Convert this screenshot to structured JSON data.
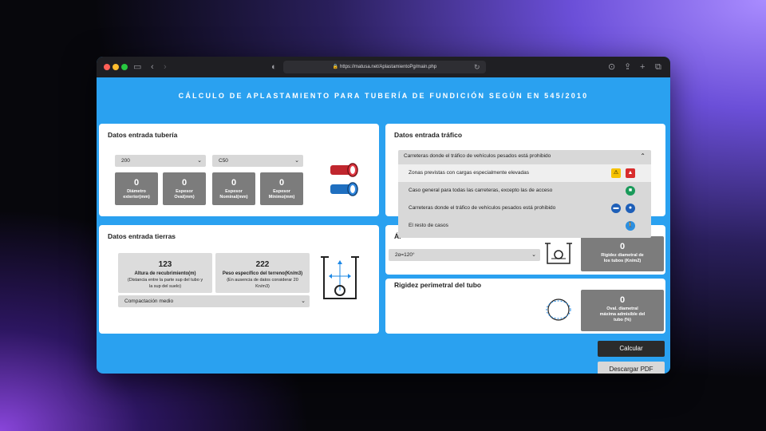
{
  "browser": {
    "url": "https://matusa.net/AplastamientoPg/main.php"
  },
  "app": {
    "title": "CÁLCULO DE APLASTAMIENTO PARA TUBERÍA DE FUNDICIÓN SEGÚN EN 545/2010"
  },
  "tuberia": {
    "title": "Datos entrada tubería",
    "diameter_select": "200",
    "class_select": "C50",
    "boxes": [
      {
        "value": "0",
        "label1": "Diámetro",
        "label2": "exterior(mm)"
      },
      {
        "value": "0",
        "label1": "Espesor",
        "label2": "Oval(mm)"
      },
      {
        "value": "0",
        "label1": "Espesor",
        "label2": "Nominal(mm)"
      },
      {
        "value": "0",
        "label1": "Espesor",
        "label2": "Mínimo(mm)"
      }
    ]
  },
  "tierras": {
    "title": "Datos entrada tierras",
    "altura": {
      "value": "123",
      "label": "Altura de recubrimiento(m)",
      "sub1": "(Distancia entre la parte sup del tubo y",
      "sub2": "la sup del suelo)"
    },
    "peso": {
      "value": "222",
      "label": "Peso específico del terreno(Kn/m3)",
      "sub1": "(En ausencia de datos considerar 20",
      "sub2": "Kn/m3)"
    },
    "compactacion_select": "Compactación medio"
  },
  "trafico": {
    "title": "Datos entrada tráfico",
    "selected": "Carreteras donde el tráfico de vehículos pesados está prohibido",
    "options": [
      "Zonas previstas con cargas especialmente elevadas",
      "Caso general para todas las carreteras, excepto las de acceso",
      "Carreteras donde el tráfico de vehículos pesados está prohibido",
      "El resto de casos"
    ]
  },
  "angulo": {
    "title_partial": "Ár",
    "select": "2α=120°",
    "rigidez_box": {
      "value": "0",
      "label1": "Rigidez diametral de",
      "label2": "los tubos (Kn/m2)"
    }
  },
  "rigidez_perimetral": {
    "title": "Rigidez perimetral del tubo",
    "oval_box": {
      "value": "0",
      "label1": "Oval. diametral",
      "label2": "máxima admisible del",
      "label3": "tubo (%)"
    }
  },
  "buttons": {
    "calcular": "Calcular",
    "descargar": "Descargar PDF"
  },
  "colors": {
    "app_background": "#2aa1f0",
    "box_gray": "#7c7c7c",
    "button_dark": "#2b2b2b"
  }
}
